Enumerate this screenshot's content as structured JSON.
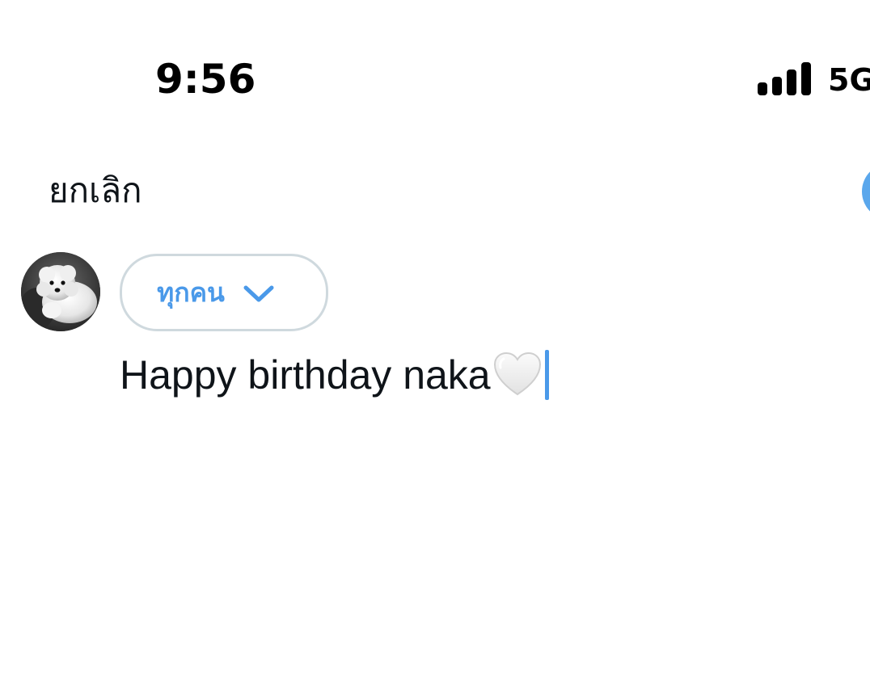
{
  "status_bar": {
    "time": "9:56",
    "network": "5G",
    "signal_icon": "signal-bars-icon"
  },
  "top_bar": {
    "cancel_label": "ยกเลิก"
  },
  "composer": {
    "audience_label": "ทุกคน",
    "audience_icon": "chevron-down-icon",
    "text": "Happy birthday naka",
    "emoji_icon": "white-heart-icon"
  },
  "colors": {
    "accent": "#4a99e9",
    "post_button": "#5aa7ec",
    "pill_border": "#cfd9de",
    "text": "#0f1419"
  }
}
